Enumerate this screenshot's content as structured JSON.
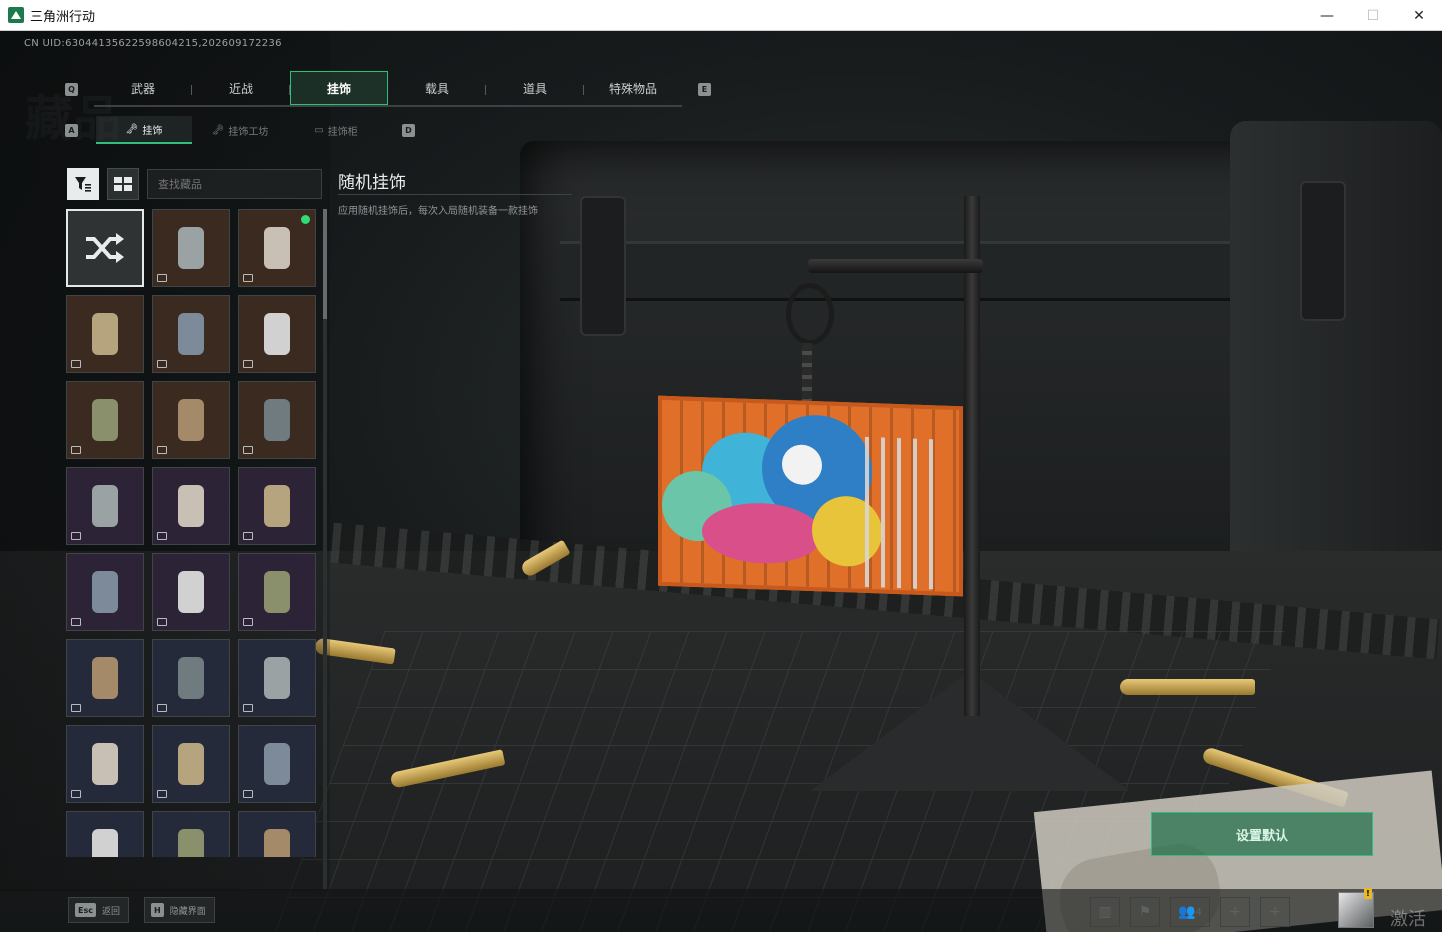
{
  "window": {
    "title": "三角洲行动",
    "minimize": "—",
    "maximize": "☐",
    "close": "✕"
  },
  "uid_text": "CN UID:6304413562259860421​5,202609172236",
  "background_watermark": "藏品",
  "main_tabs": {
    "key_left": "Q",
    "key_right": "E",
    "items": [
      {
        "label": "武器"
      },
      {
        "label": "近战"
      },
      {
        "label": "挂饰",
        "active": true
      },
      {
        "label": "载具"
      },
      {
        "label": "道具"
      },
      {
        "label": "特殊物品"
      }
    ]
  },
  "sub_tabs": {
    "key_left": "A",
    "key_right": "D",
    "items": [
      {
        "label": "挂饰",
        "active": true
      },
      {
        "label": "挂饰工坊"
      },
      {
        "label": "挂饰柜"
      }
    ]
  },
  "toolbar": {
    "search_placeholder": "查找藏品"
  },
  "detail": {
    "title": "随机挂饰",
    "description": "应用随机挂饰后，每次入局随机装备一款挂饰"
  },
  "set_default_label": "设置默认",
  "bottom_hints": [
    {
      "key": "Esc",
      "label": "返回"
    },
    {
      "key": "H",
      "label": "隐藏界面"
    }
  ],
  "friends_count": "4",
  "avatar_badge": "!",
  "activate_text": "激活 W",
  "colors": {
    "accent_green": "#2fbf7a",
    "owned_dot": "#2fdc75"
  },
  "items": [
    {
      "kind": "random",
      "icon": "shuffle-icon"
    },
    {
      "kind": "charm",
      "tone": "brown"
    },
    {
      "kind": "charm",
      "tone": "brown",
      "equipped": true
    },
    {
      "kind": "charm",
      "tone": "brown"
    },
    {
      "kind": "charm",
      "tone": "brown"
    },
    {
      "kind": "charm",
      "tone": "brown"
    },
    {
      "kind": "charm",
      "tone": "brown"
    },
    {
      "kind": "charm",
      "tone": "brown"
    },
    {
      "kind": "charm",
      "tone": "brown"
    },
    {
      "kind": "charm",
      "tone": "purple"
    },
    {
      "kind": "charm",
      "tone": "purple"
    },
    {
      "kind": "charm",
      "tone": "purple"
    },
    {
      "kind": "charm",
      "tone": "purple"
    },
    {
      "kind": "charm",
      "tone": "purple"
    },
    {
      "kind": "charm",
      "tone": "purple"
    },
    {
      "kind": "charm",
      "tone": "blue"
    },
    {
      "kind": "charm",
      "tone": "blue"
    },
    {
      "kind": "charm",
      "tone": "blue"
    },
    {
      "kind": "charm",
      "tone": "blue"
    },
    {
      "kind": "charm",
      "tone": "blue"
    },
    {
      "kind": "charm",
      "tone": "blue"
    },
    {
      "kind": "charm",
      "tone": "blue"
    },
    {
      "kind": "charm",
      "tone": "blue"
    },
    {
      "kind": "charm",
      "tone": "blue"
    }
  ]
}
